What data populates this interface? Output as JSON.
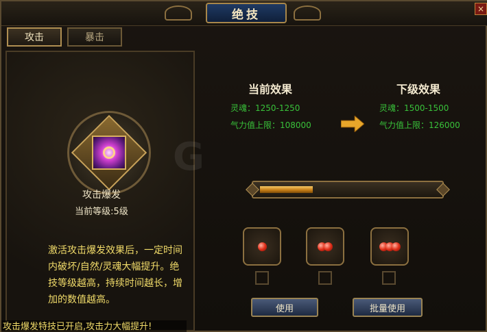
{
  "window": {
    "title": "绝技",
    "close_label": "×"
  },
  "tabs": [
    {
      "label": "攻击",
      "active": true
    },
    {
      "label": "暴击",
      "active": false
    }
  ],
  "skill": {
    "name": "攻击爆发",
    "level": "当前等级:5级",
    "description": "激活攻击爆发效果后，一定时间内破坏/自然/灵魂大幅提升。绝技等级越高，持续时间越长，增加的数值越高。"
  },
  "current_effect": {
    "title": "当前效果",
    "soul": "灵魂：1250-1250",
    "qi_limit": "气力值上限：108000"
  },
  "next_effect": {
    "title": "下级效果",
    "soul": "灵魂：1500-1500",
    "qi_limit": "气力值上限：126000"
  },
  "progress": {
    "fraction": 0.3
  },
  "items": [
    {
      "name": "orb-bowl-1",
      "orbs": 1
    },
    {
      "name": "orb-bowl-2",
      "orbs": 2
    },
    {
      "name": "orb-bowl-3",
      "orbs": 3
    }
  ],
  "buttons": {
    "use": "使用",
    "batch_use": "批量使用"
  },
  "marquee": "攻击爆发特技已开启,攻击力大幅提升!",
  "watermark": "G",
  "colors": {
    "stat_green": "#39c23a",
    "desc_yellow": "#f2dc6a",
    "gold_border": "#b08f52"
  }
}
